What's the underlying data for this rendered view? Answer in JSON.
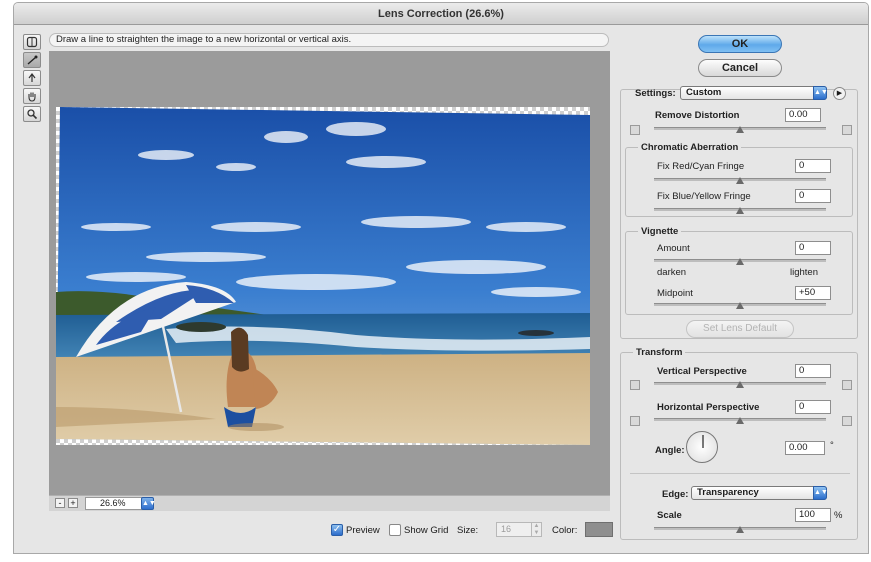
{
  "window": {
    "title": "Lens Correction (26.6%)"
  },
  "hint": "Draw a line to straighten the image to a new horizontal or vertical axis.",
  "tools": [
    {
      "name": "remove-distortion-tool-icon"
    },
    {
      "name": "straighten-tool-icon"
    },
    {
      "name": "move-grid-tool-icon"
    },
    {
      "name": "hand-tool-icon"
    },
    {
      "name": "zoom-tool-icon"
    }
  ],
  "status": {
    "zoom_out": "-",
    "zoom_in": "+",
    "zoom": "26.6%"
  },
  "bottom": {
    "preview_label": "Preview",
    "preview_checked": true,
    "grid_label": "Show Grid",
    "grid_checked": false,
    "size_label": "Size:",
    "size_value": "16",
    "color_label": "Color:",
    "grid_color": "#8f8f8f"
  },
  "buttons": {
    "ok": "OK",
    "cancel": "Cancel",
    "set_default": "Set Lens Default"
  },
  "settings": {
    "label": "Settings:",
    "value": "Custom"
  },
  "remove_distortion": {
    "label": "Remove Distortion",
    "value": "0.00",
    "level": 0.5
  },
  "chromatic": {
    "title": "Chromatic Aberration",
    "red_cyan": {
      "label": "Fix Red/Cyan Fringe",
      "value": "0",
      "level": 0.5
    },
    "blue_yellow": {
      "label": "Fix Blue/Yellow Fringe",
      "value": "0",
      "level": 0.5
    }
  },
  "vignette": {
    "title": "Vignette",
    "amount": {
      "label": "Amount",
      "value": "0",
      "level": 0.5
    },
    "darken": "darken",
    "lighten": "lighten",
    "midpoint": {
      "label": "Midpoint",
      "value": "+50",
      "level": 0.5
    }
  },
  "transform": {
    "title": "Transform",
    "vertical": {
      "label": "Vertical Perspective",
      "value": "0",
      "level": 0.5
    },
    "horizontal": {
      "label": "Horizontal Perspective",
      "value": "0",
      "level": 0.5
    },
    "angle": {
      "label": "Angle:",
      "value": "0.00",
      "unit": "°"
    },
    "edge": {
      "label": "Edge:",
      "value": "Transparency"
    },
    "scale": {
      "label": "Scale",
      "value": "100",
      "unit": "%",
      "level": 0.5
    }
  },
  "colors": {
    "accent": "#4f9be6",
    "sky": "#1f63b8",
    "sand": "#d9c39b"
  }
}
